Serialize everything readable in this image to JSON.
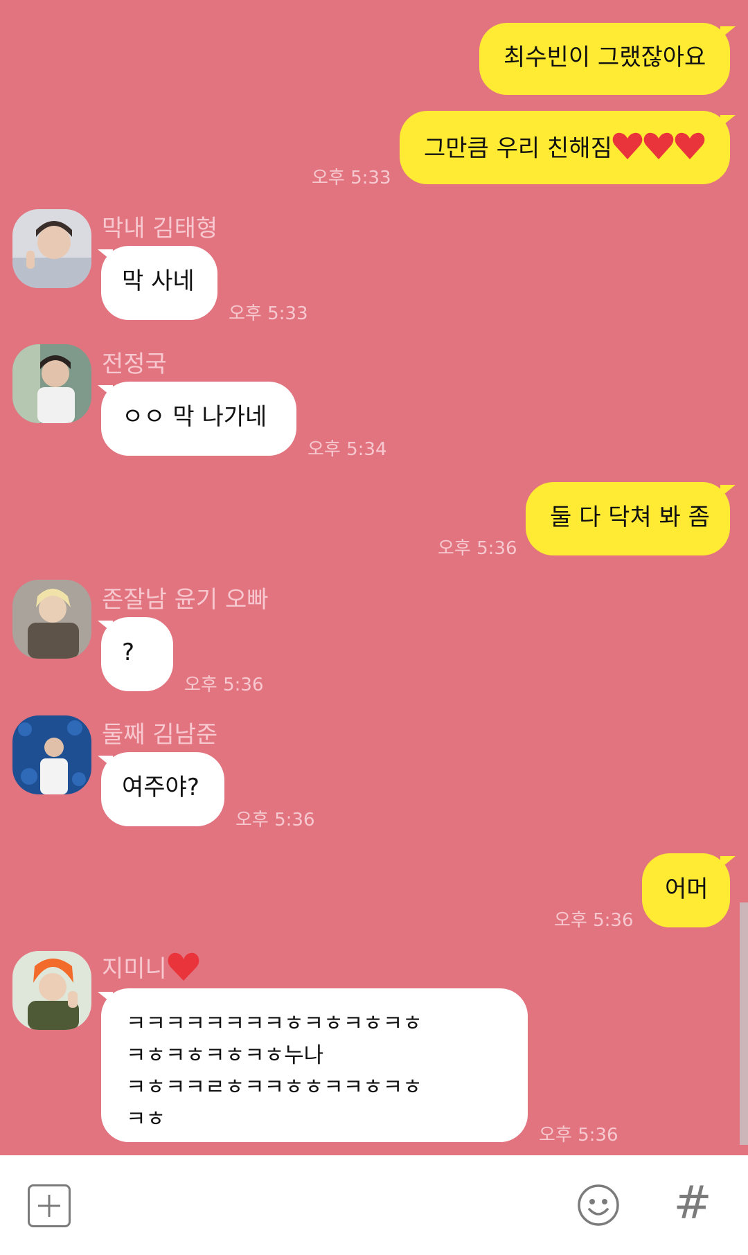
{
  "messages": [
    {
      "from": "me",
      "text": "최수빈이 그랬잖아요"
    },
    {
      "from": "me",
      "text": "그만큼 우리 친해짐",
      "suffix_icon": "heart-x3",
      "time": "오후 5:33"
    },
    {
      "from": "other",
      "sender": "막내 김태형",
      "text": "막 사네",
      "time": "오후 5:33"
    },
    {
      "from": "other",
      "sender": "전정국",
      "text": "ㅇㅇ 막 나가네",
      "time": "오후 5:34"
    },
    {
      "from": "me",
      "text": "둘 다 닥쳐 봐 좀",
      "time": "오후 5:36"
    },
    {
      "from": "other",
      "sender": "존잘남 윤기 오빠",
      "text": "?",
      "time": "오후 5:36"
    },
    {
      "from": "other",
      "sender": "둘째 김남준",
      "text": "여주야?",
      "time": "오후 5:36"
    },
    {
      "from": "me",
      "text": "어머",
      "time": "오후 5:36"
    },
    {
      "from": "other",
      "sender": "지미니",
      "sender_icon": "heart",
      "lines": [
        "ㅋㅋㅋㅋㅋㅋㅋㅋㅎㅋㅎㅋㅎㅋㅎ",
        "ㅋㅎㅋㅎㅋㅎㅋㅎ누나",
        "ㅋㅎㅋㅋㄹㅎㅋㅋㅎㅎㅋㅋㅎㅋㅎ",
        "ㅋㅎ"
      ],
      "time": "오후 5:36"
    }
  ],
  "input_bar": {
    "plus_icon": "plus-icon",
    "emoji_icon": "emoji-icon",
    "hash_symbol": "#"
  },
  "colors": {
    "background": "#e27480",
    "my_bubble": "#ffeb33",
    "other_bubble": "#ffffff",
    "heart": "#e8343a"
  }
}
